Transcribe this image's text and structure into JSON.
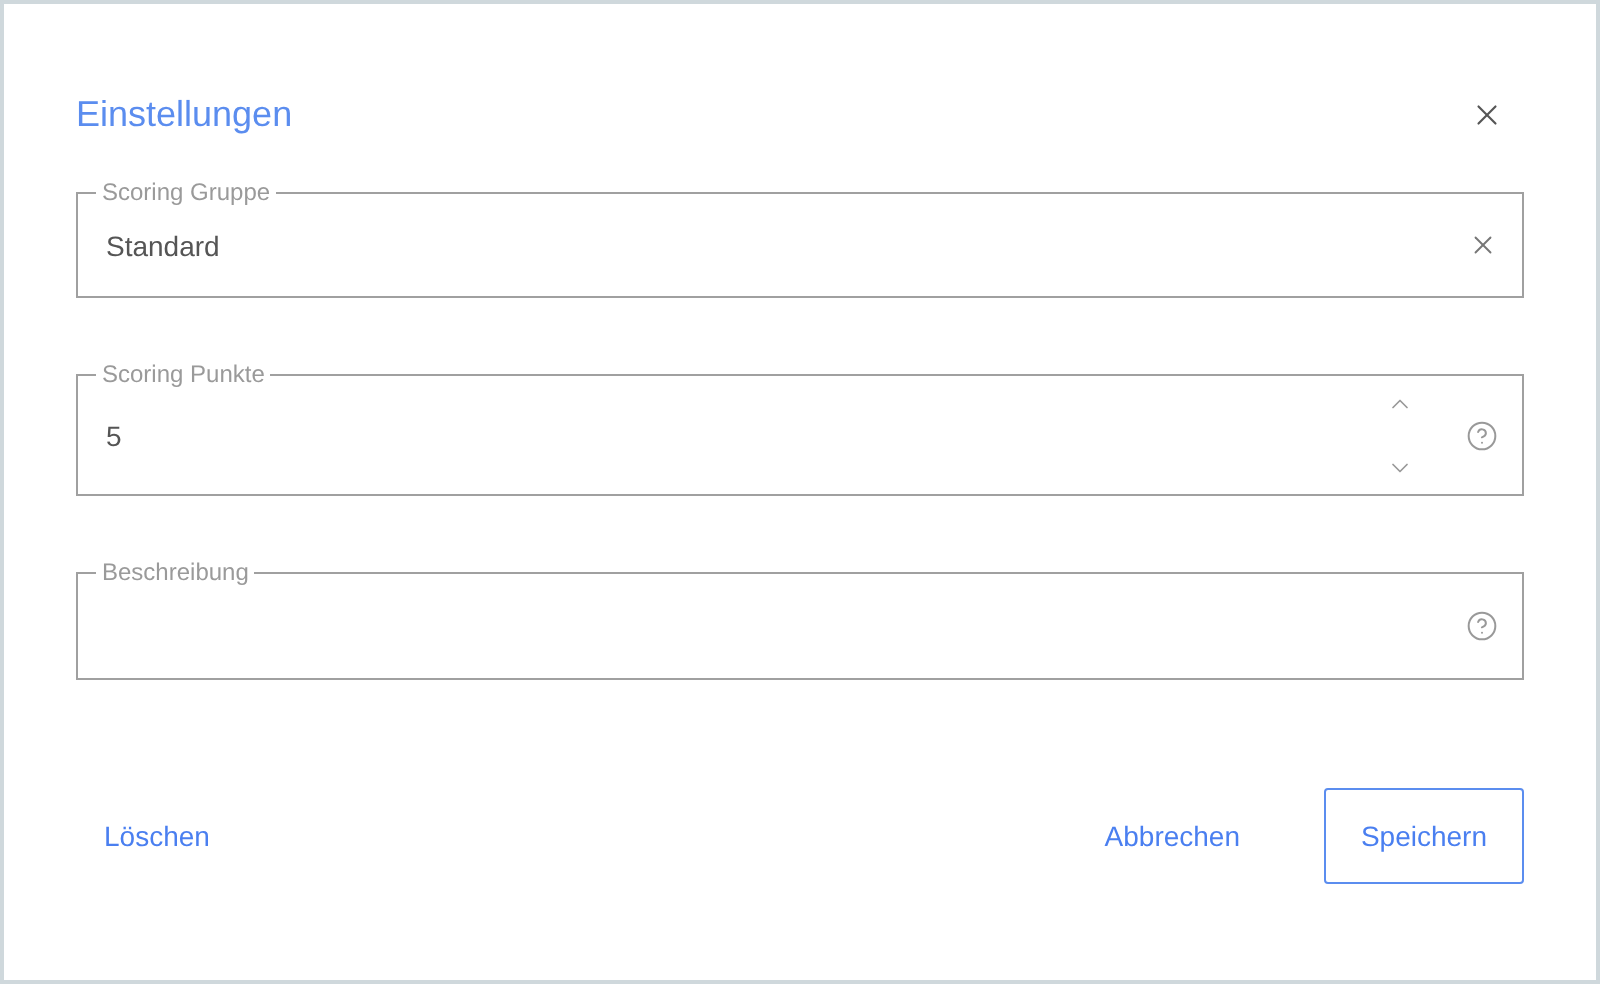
{
  "dialog": {
    "title": "Einstellungen"
  },
  "fields": [
    {
      "kind": "select",
      "label": "Scoring Gruppe",
      "value": "Standard"
    },
    {
      "kind": "number",
      "label": "Scoring Punkte",
      "value": "5"
    },
    {
      "kind": "text",
      "label": "Beschreibung"
    }
  ],
  "buttons": [
    {
      "kind": "text",
      "label": "Löschen"
    },
    {
      "kind": "text",
      "label": "Abbrechen"
    },
    {
      "kind": "outlined",
      "label": "Speichern"
    }
  ]
}
